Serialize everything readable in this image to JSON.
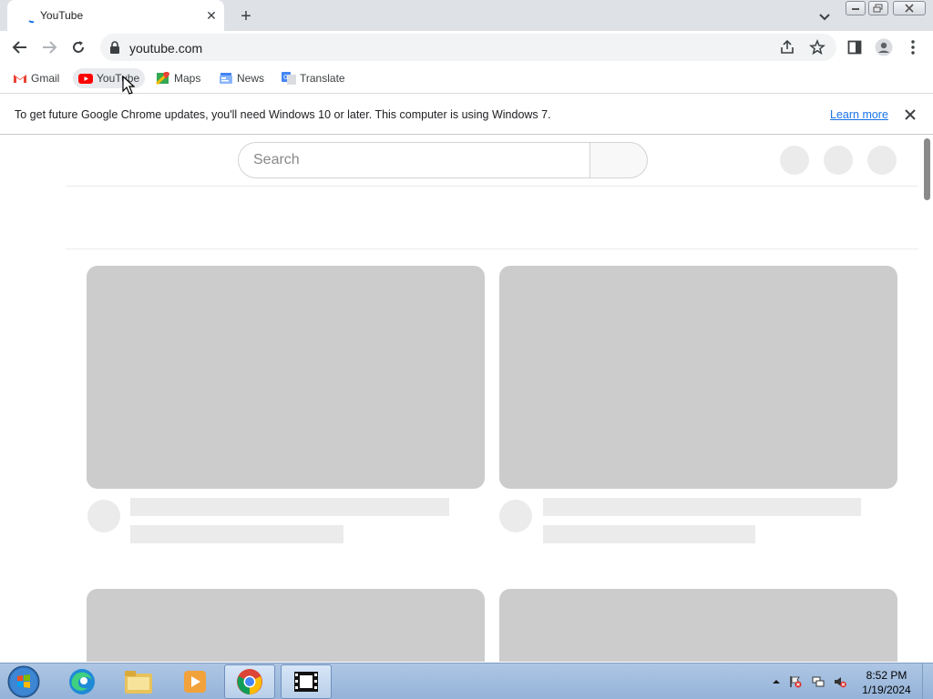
{
  "tab": {
    "title": "YouTube"
  },
  "address_bar": {
    "url": "youtube.com"
  },
  "bookmarks": [
    {
      "label": "Gmail",
      "icon": "gmail-icon"
    },
    {
      "label": "YouTube",
      "icon": "youtube-icon"
    },
    {
      "label": "Maps",
      "icon": "maps-icon"
    },
    {
      "label": "News",
      "icon": "news-icon"
    },
    {
      "label": "Translate",
      "icon": "translate-icon"
    }
  ],
  "infobar": {
    "message": "To get future Google Chrome updates, you'll need Windows 10 or later. This computer is using Windows 7.",
    "link": "Learn more"
  },
  "page": {
    "search_placeholder": "Search"
  },
  "taskbar": {
    "time": "8:52 PM",
    "date": "1/19/2024",
    "apps": [
      "start-orb-icon",
      "edge-icon",
      "file-explorer-icon",
      "media-player-icon",
      "chrome-icon",
      "film-app-icon"
    ]
  },
  "colors": {
    "tab_strip": "#dee1e6",
    "omnibox": "#f1f3f4",
    "link": "#1a73e8",
    "skeleton": "#cccccc",
    "skeleton_light": "#ebebeb",
    "youtube_red": "#ff0000"
  }
}
